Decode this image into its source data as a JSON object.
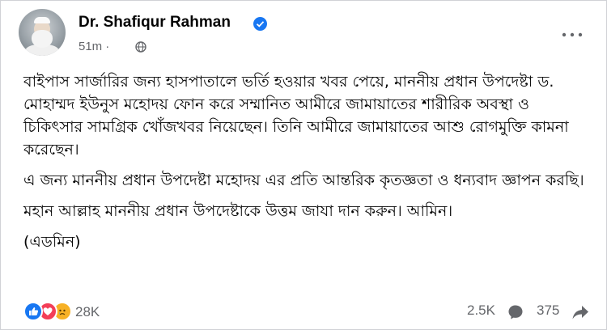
{
  "post": {
    "author": "Dr. Shafiqur Rahman",
    "time": "51m",
    "separator": "·",
    "paragraphs": [
      "বাইপাস সার্জারির জন্য হাসপাতালে ভর্তি হওয়ার খবর পেয়ে, মাননীয় প্রধান উপদেষ্টা ড. মোহাম্মদ ইউনুস মহোদয় ফোন করে সম্মানিত আমীরে জামায়াতের শারীরিক অবস্থা ও চিকিৎসার সামগ্রিক খোঁজখবর নিয়েছেন। তিনি আমীরে জামায়াতের আশু রোগমুক্তি কামনা করেছেন।",
      "এ জন্য মাননীয় প্রধান উপদেষ্টা মহোদয় এর প্রতি আন্তরিক কৃতজ্ঞতা ও ধন্যবাদ জ্ঞাপন করছি।",
      "মহান আল্লাহ মাননীয় প্রধান উপদেষ্টাকে উত্তম জাযা দান করুন। আমিন।",
      "(এডমিন)"
    ]
  },
  "engagement": {
    "reactions_count": "28K",
    "comments_count": "2.5K",
    "shares_count": "375"
  },
  "icons": {
    "verified": "verified-badge-icon",
    "privacy": "globe-icon",
    "more": "more-options-icon",
    "like": "like-reaction-icon",
    "love": "love-reaction-icon",
    "sad": "sad-reaction-icon",
    "comment": "comment-icon",
    "share": "share-icon"
  },
  "colors": {
    "brand_blue": "#1877f2",
    "love_red": "#f33e58",
    "sad_yellow": "#f7b125",
    "secondary_text": "#65676b"
  }
}
